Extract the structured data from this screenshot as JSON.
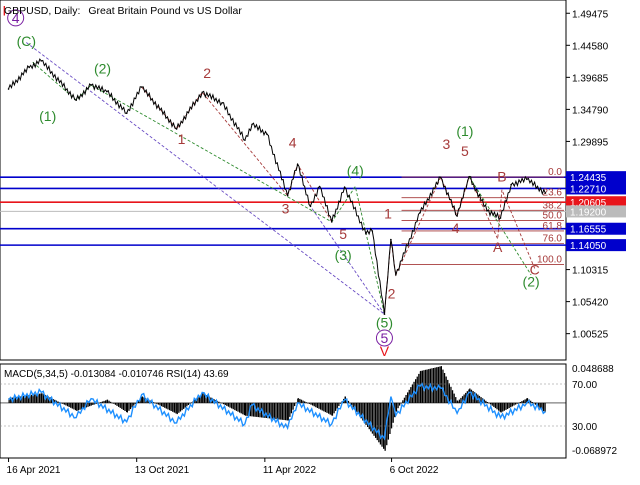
{
  "chart_title": {
    "symbol_period": "GBPUSD, Daily:",
    "description": "Great Britain Pound vs US Dollar"
  },
  "chart_data": {
    "type": "line",
    "symbol": "GBPUSD",
    "timeframe": "Daily",
    "x_axis_labels": [
      "16 Apr 2021",
      "13 Oct 2021",
      "11 Apr 2022",
      "6 Oct 2022"
    ],
    "price_axis": {
      "ticks": [
        "1.49475",
        "1.44580",
        "1.39685",
        "1.34790",
        "1.29895",
        "1.10315",
        "1.05420",
        "1.00525"
      ],
      "range": [
        0.965,
        1.515
      ]
    },
    "price_series": [
      {
        "d": "2021-04-16",
        "v": 1.379
      },
      {
        "d": "2021-05-15",
        "v": 1.412
      },
      {
        "d": "2021-06-01",
        "v": 1.422
      },
      {
        "d": "2021-07-20",
        "v": 1.362
      },
      {
        "d": "2021-08-10",
        "v": 1.385
      },
      {
        "d": "2021-09-01",
        "v": 1.375
      },
      {
        "d": "2021-09-29",
        "v": 1.342
      },
      {
        "d": "2021-10-20",
        "v": 1.382
      },
      {
        "d": "2021-12-08",
        "v": 1.318
      },
      {
        "d": "2022-01-13",
        "v": 1.374
      },
      {
        "d": "2022-02-10",
        "v": 1.358
      },
      {
        "d": "2022-03-14",
        "v": 1.301
      },
      {
        "d": "2022-03-24",
        "v": 1.325
      },
      {
        "d": "2022-04-14",
        "v": 1.31
      },
      {
        "d": "2022-05-13",
        "v": 1.216
      },
      {
        "d": "2022-05-27",
        "v": 1.264
      },
      {
        "d": "2022-06-14",
        "v": 1.2
      },
      {
        "d": "2022-06-27",
        "v": 1.23
      },
      {
        "d": "2022-07-14",
        "v": 1.176
      },
      {
        "d": "2022-08-01",
        "v": 1.229
      },
      {
        "d": "2022-08-31",
        "v": 1.158
      },
      {
        "d": "2022-09-09",
        "v": 1.162
      },
      {
        "d": "2022-09-26",
        "v": 1.035
      },
      {
        "d": "2022-10-05",
        "v": 1.149
      },
      {
        "d": "2022-10-12",
        "v": 1.095
      },
      {
        "d": "2022-11-15",
        "v": 1.19
      },
      {
        "d": "2022-12-14",
        "v": 1.244
      },
      {
        "d": "2023-01-06",
        "v": 1.185
      },
      {
        "d": "2023-01-23",
        "v": 1.245
      },
      {
        "d": "2023-02-17",
        "v": 1.193
      },
      {
        "d": "2023-03-08",
        "v": 1.182
      },
      {
        "d": "2023-03-23",
        "v": 1.233
      },
      {
        "d": "2023-04-14",
        "v": 1.241
      },
      {
        "d": "2023-05-10",
        "v": 1.22
      }
    ],
    "horizontal_levels": [
      {
        "value": 1.24435,
        "label": "1.24435",
        "color": "#0000cc"
      },
      {
        "value": 1.2271,
        "label": "1.22710",
        "color": "#0000cc"
      },
      {
        "value": 1.20605,
        "label": "1.20605",
        "color": "#e8141a"
      },
      {
        "value": 1.192,
        "label": "1.19200",
        "color": "#bbbbbb"
      },
      {
        "value": 1.16555,
        "label": "1.16555",
        "color": "#0000cc"
      },
      {
        "value": 1.1405,
        "label": "1.14050",
        "color": "#0000cc"
      }
    ],
    "fibonacci_retracement": [
      {
        "label": "0.0",
        "value": 1.2445
      },
      {
        "label": "23.6",
        "value": 1.213
      },
      {
        "label": "38.2",
        "value": 1.1937
      },
      {
        "label": "50.0",
        "value": 1.178
      },
      {
        "label": "61.8",
        "value": 1.1622
      },
      {
        "label": "76.0",
        "value": 1.1432
      },
      {
        "label": "100.0",
        "value": 1.111
      }
    ],
    "wave_labels": [
      {
        "text": "I",
        "d": "2021-04-10",
        "v": 1.4915,
        "color": "#e8141a"
      },
      {
        "text": "4",
        "d": "2021-04-26",
        "v": 1.48,
        "color": "#7a1fa2",
        "circled": true
      },
      {
        "text": "(C)",
        "d": "2021-05-11",
        "v": 1.4445,
        "color": "#2e8b2e"
      },
      {
        "text": "(2)",
        "d": "2021-08-26",
        "v": 1.4025,
        "color": "#2e8b2e"
      },
      {
        "text": "(1)",
        "d": "2021-06-10",
        "v": 1.33,
        "color": "#2e8b2e"
      },
      {
        "text": "2",
        "d": "2022-01-20",
        "v": 1.396,
        "color": "#a63a3a"
      },
      {
        "text": "1",
        "d": "2021-12-15",
        "v": 1.295,
        "color": "#a63a3a"
      },
      {
        "text": "4",
        "d": "2022-05-20",
        "v": 1.29,
        "color": "#a63a3a"
      },
      {
        "text": "3",
        "d": "2022-05-10",
        "v": 1.189,
        "color": "#a63a3a"
      },
      {
        "text": "(4)",
        "d": "2022-08-16",
        "v": 1.247,
        "color": "#2e8b2e"
      },
      {
        "text": "5",
        "d": "2022-07-30",
        "v": 1.15,
        "color": "#a63a3a"
      },
      {
        "text": "(3)",
        "d": "2022-07-30",
        "v": 1.118,
        "color": "#2e8b2e"
      },
      {
        "text": "1",
        "d": "2022-10-01",
        "v": 1.181,
        "color": "#a63a3a"
      },
      {
        "text": "2",
        "d": "2022-10-06",
        "v": 1.059,
        "color": "#a63a3a"
      },
      {
        "text": "(5)",
        "d": "2022-09-26",
        "v": 1.015,
        "color": "#2e8b2e"
      },
      {
        "text": "5",
        "d": "2022-09-26",
        "v": 0.991,
        "color": "#7a1fa2",
        "circled": true
      },
      {
        "text": "V",
        "d": "2022-09-26",
        "v": 0.971,
        "color": "#e8141a"
      },
      {
        "text": "3",
        "d": "2022-12-22",
        "v": 1.287,
        "color": "#a63a3a"
      },
      {
        "text": "(1)",
        "d": "2023-01-17",
        "v": 1.307,
        "color": "#2e8b2e"
      },
      {
        "text": "5",
        "d": "2023-01-17",
        "v": 1.277,
        "color": "#a63a3a"
      },
      {
        "text": "4",
        "d": "2023-01-04",
        "v": 1.159,
        "color": "#a63a3a"
      },
      {
        "text": "B",
        "d": "2023-03-10",
        "v": 1.238,
        "color": "#a63a3a"
      },
      {
        "text": "A",
        "d": "2023-03-04",
        "v": 1.13,
        "color": "#a63a3a"
      },
      {
        "text": "C",
        "d": "2023-04-25",
        "v": 1.096,
        "color": "#a63a3a"
      },
      {
        "text": "(2)",
        "d": "2023-04-20",
        "v": 1.077,
        "color": "#2e8b2e"
      }
    ],
    "wave_paths": [
      {
        "color": "#6a4dc4",
        "points": [
          {
            "d": "2021-05-11",
            "v": 1.45
          },
          {
            "d": "2022-09-26",
            "v": 1.035
          }
        ]
      },
      {
        "color": "#6a4dc4",
        "points": [
          {
            "d": "2022-09-26",
            "v": 1.035
          },
          {
            "d": "2022-06-14",
            "v": 1.2
          }
        ]
      },
      {
        "color": "#2e8b2e",
        "points": [
          {
            "d": "2021-05-20",
            "v": 1.42
          },
          {
            "d": "2021-07-20",
            "v": 1.362
          },
          {
            "d": "2021-08-10",
            "v": 1.385
          },
          {
            "d": "2022-07-14",
            "v": 1.176
          },
          {
            "d": "2022-08-16",
            "v": 1.23
          },
          {
            "d": "2022-09-26",
            "v": 1.035
          }
        ]
      },
      {
        "color": "#a63a3a",
        "points": [
          {
            "d": "2021-10-20",
            "v": 1.382
          },
          {
            "d": "2021-12-08",
            "v": 1.318
          },
          {
            "d": "2022-01-13",
            "v": 1.374
          },
          {
            "d": "2022-05-13",
            "v": 1.216
          },
          {
            "d": "2022-05-27",
            "v": 1.264
          },
          {
            "d": "2022-07-14",
            "v": 1.176
          }
        ]
      },
      {
        "color": "#a63a3a",
        "points": [
          {
            "d": "2022-09-26",
            "v": 1.035
          },
          {
            "d": "2022-10-05",
            "v": 1.149
          },
          {
            "d": "2022-10-12",
            "v": 1.095
          },
          {
            "d": "2022-12-14",
            "v": 1.244
          },
          {
            "d": "2023-01-06",
            "v": 1.185
          },
          {
            "d": "2023-01-23",
            "v": 1.245
          }
        ]
      },
      {
        "color": "#a63a3a",
        "points": [
          {
            "d": "2023-01-23",
            "v": 1.245
          },
          {
            "d": "2023-03-04",
            "v": 1.15
          },
          {
            "d": "2023-03-10",
            "v": 1.225
          },
          {
            "d": "2023-04-25",
            "v": 1.105
          }
        ]
      },
      {
        "color": "#2e8b2e",
        "points": [
          {
            "d": "2023-01-23",
            "v": 1.245
          },
          {
            "d": "2023-04-20",
            "v": 1.095
          }
        ]
      }
    ],
    "indicator": {
      "label": "MACD(5,34,5) -0.013084 -0.010746 RSI(14) 43.69",
      "left_ticks": [
        "0.048688",
        "-0.068972"
      ],
      "right_ticks": [
        "70.00",
        "30.00"
      ],
      "macd_histogram": [
        {
          "d": "2021-04-16",
          "v": 0.006
        },
        {
          "d": "2021-06-01",
          "v": 0.012
        },
        {
          "d": "2021-07-20",
          "v": -0.01
        },
        {
          "d": "2021-09-01",
          "v": 0.004
        },
        {
          "d": "2021-09-29",
          "v": -0.012
        },
        {
          "d": "2021-10-20",
          "v": 0.008
        },
        {
          "d": "2021-12-08",
          "v": -0.014
        },
        {
          "d": "2022-01-13",
          "v": 0.012
        },
        {
          "d": "2022-03-14",
          "v": -0.016
        },
        {
          "d": "2022-05-13",
          "v": -0.022
        },
        {
          "d": "2022-05-27",
          "v": 0.006
        },
        {
          "d": "2022-07-14",
          "v": -0.016
        },
        {
          "d": "2022-08-01",
          "v": 0.008
        },
        {
          "d": "2022-09-26",
          "v": -0.06
        },
        {
          "d": "2022-10-12",
          "v": -0.01
        },
        {
          "d": "2022-11-15",
          "v": 0.04
        },
        {
          "d": "2022-12-14",
          "v": 0.046
        },
        {
          "d": "2023-01-06",
          "v": 0.002
        },
        {
          "d": "2023-01-23",
          "v": 0.018
        },
        {
          "d": "2023-03-08",
          "v": -0.012
        },
        {
          "d": "2023-04-14",
          "v": 0.006
        },
        {
          "d": "2023-05-10",
          "v": -0.013
        }
      ],
      "rsi_series": [
        {
          "d": "2021-04-16",
          "v": 55
        },
        {
          "d": "2021-06-01",
          "v": 62
        },
        {
          "d": "2021-07-20",
          "v": 38
        },
        {
          "d": "2021-08-10",
          "v": 56
        },
        {
          "d": "2021-09-29",
          "v": 34
        },
        {
          "d": "2021-10-20",
          "v": 60
        },
        {
          "d": "2021-12-08",
          "v": 33
        },
        {
          "d": "2022-01-13",
          "v": 62
        },
        {
          "d": "2022-03-14",
          "v": 32
        },
        {
          "d": "2022-03-24",
          "v": 50
        },
        {
          "d": "2022-05-13",
          "v": 28
        },
        {
          "d": "2022-05-27",
          "v": 52
        },
        {
          "d": "2022-07-14",
          "v": 32
        },
        {
          "d": "2022-08-01",
          "v": 55
        },
        {
          "d": "2022-09-26",
          "v": 18
        },
        {
          "d": "2022-10-05",
          "v": 58
        },
        {
          "d": "2022-10-12",
          "v": 40
        },
        {
          "d": "2022-11-15",
          "v": 68
        },
        {
          "d": "2022-12-14",
          "v": 66
        },
        {
          "d": "2023-01-06",
          "v": 42
        },
        {
          "d": "2023-01-23",
          "v": 62
        },
        {
          "d": "2023-03-08",
          "v": 38
        },
        {
          "d": "2023-04-14",
          "v": 52
        },
        {
          "d": "2023-05-10",
          "v": 43.69
        }
      ],
      "rsi_color": "#1e90ff",
      "histogram_color": "#000000"
    },
    "grid": false
  }
}
